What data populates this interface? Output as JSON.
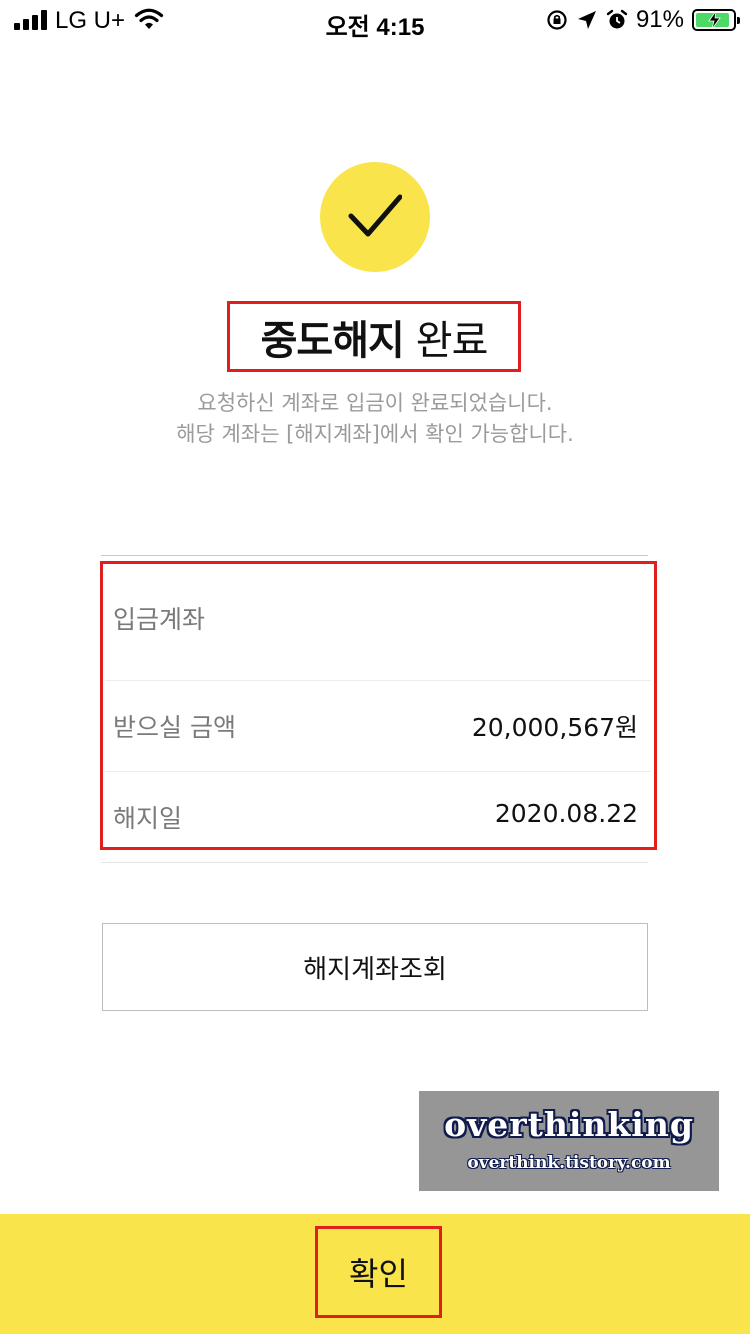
{
  "status_bar": {
    "carrier": "LG U+",
    "time": "오전 4:15",
    "battery_percent": "91%",
    "battery_level": 0.91,
    "signal_bars": 4,
    "icons": [
      "signal-icon",
      "wifi-icon",
      "rotation-lock-icon",
      "location-arrow-icon",
      "alarm-icon",
      "battery-charging-icon"
    ]
  },
  "result": {
    "icon": "checkmark-icon",
    "title_strong": "중도해지",
    "title_rest": "완료",
    "message_line1": "요청하신 계좌로 입금이 완료되었습니다.",
    "message_line2": "해당 계좌는 [해지계좌]에서 확인 가능합니다."
  },
  "details": [
    {
      "label": "입금계좌",
      "value": ""
    },
    {
      "label": "받으실 금액",
      "value": "20,000,567원"
    },
    {
      "label": "해지일",
      "value": "2020.08.22"
    }
  ],
  "buttons": {
    "view_closed_account": "해지계좌조회",
    "confirm": "확인"
  },
  "watermark": {
    "title": "overthinking",
    "url": "overthink.tistory.com"
  },
  "colors": {
    "accent_yellow": "#fae44c",
    "highlight_red": "#e01e1e",
    "watermark_gray": "#969696"
  }
}
